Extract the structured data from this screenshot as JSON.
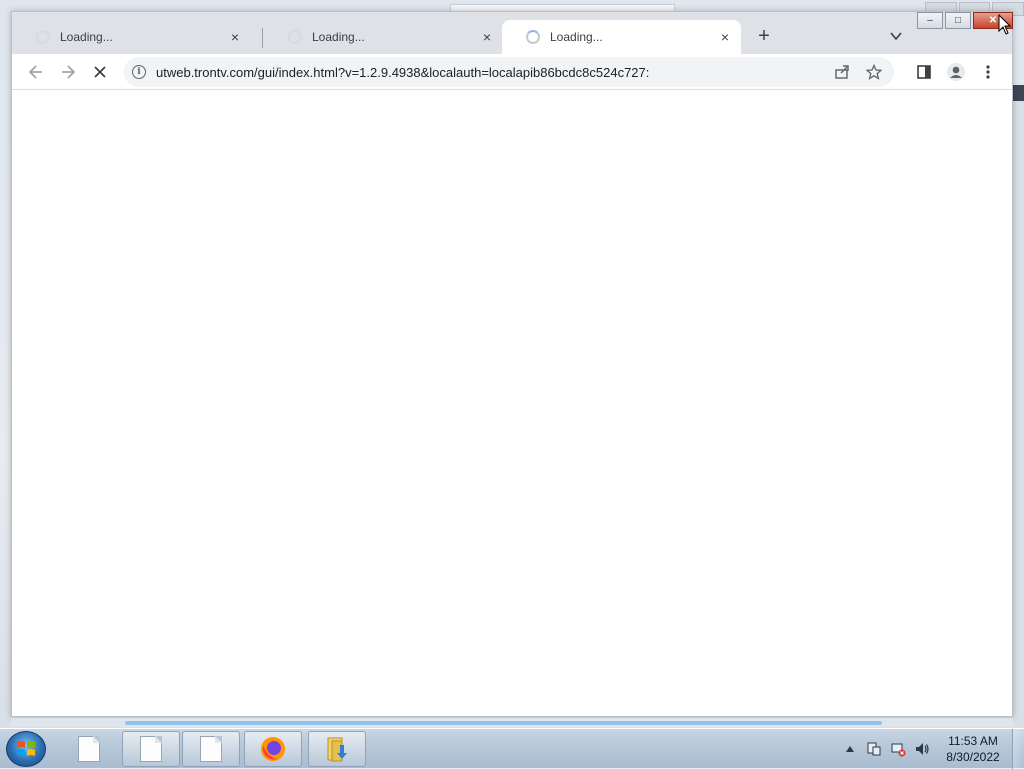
{
  "browser": {
    "tabs": [
      {
        "title": "Loading...",
        "close": "×"
      },
      {
        "title": "Loading...",
        "close": "×"
      },
      {
        "title": "Loading...",
        "close": "×"
      }
    ],
    "active_tab": 2,
    "new_tab_label": "+",
    "window_controls": {
      "minimize": "–",
      "maximize": "□",
      "close": "✕"
    },
    "toolbar": {
      "url": "utweb.trontv.com/gui/index.html?v=1.2.9.4938&localauth=localapib86bcdc8c524c727:",
      "info_label": "i"
    }
  },
  "taskbar": {
    "clock_time": "11:53 AM",
    "clock_date": "8/30/2022"
  },
  "colors": {
    "tabstrip": "#dee1e6",
    "omnibox": "#f1f3f4",
    "close_button": "#c7422a",
    "taskbar": "#b5c6d8"
  }
}
